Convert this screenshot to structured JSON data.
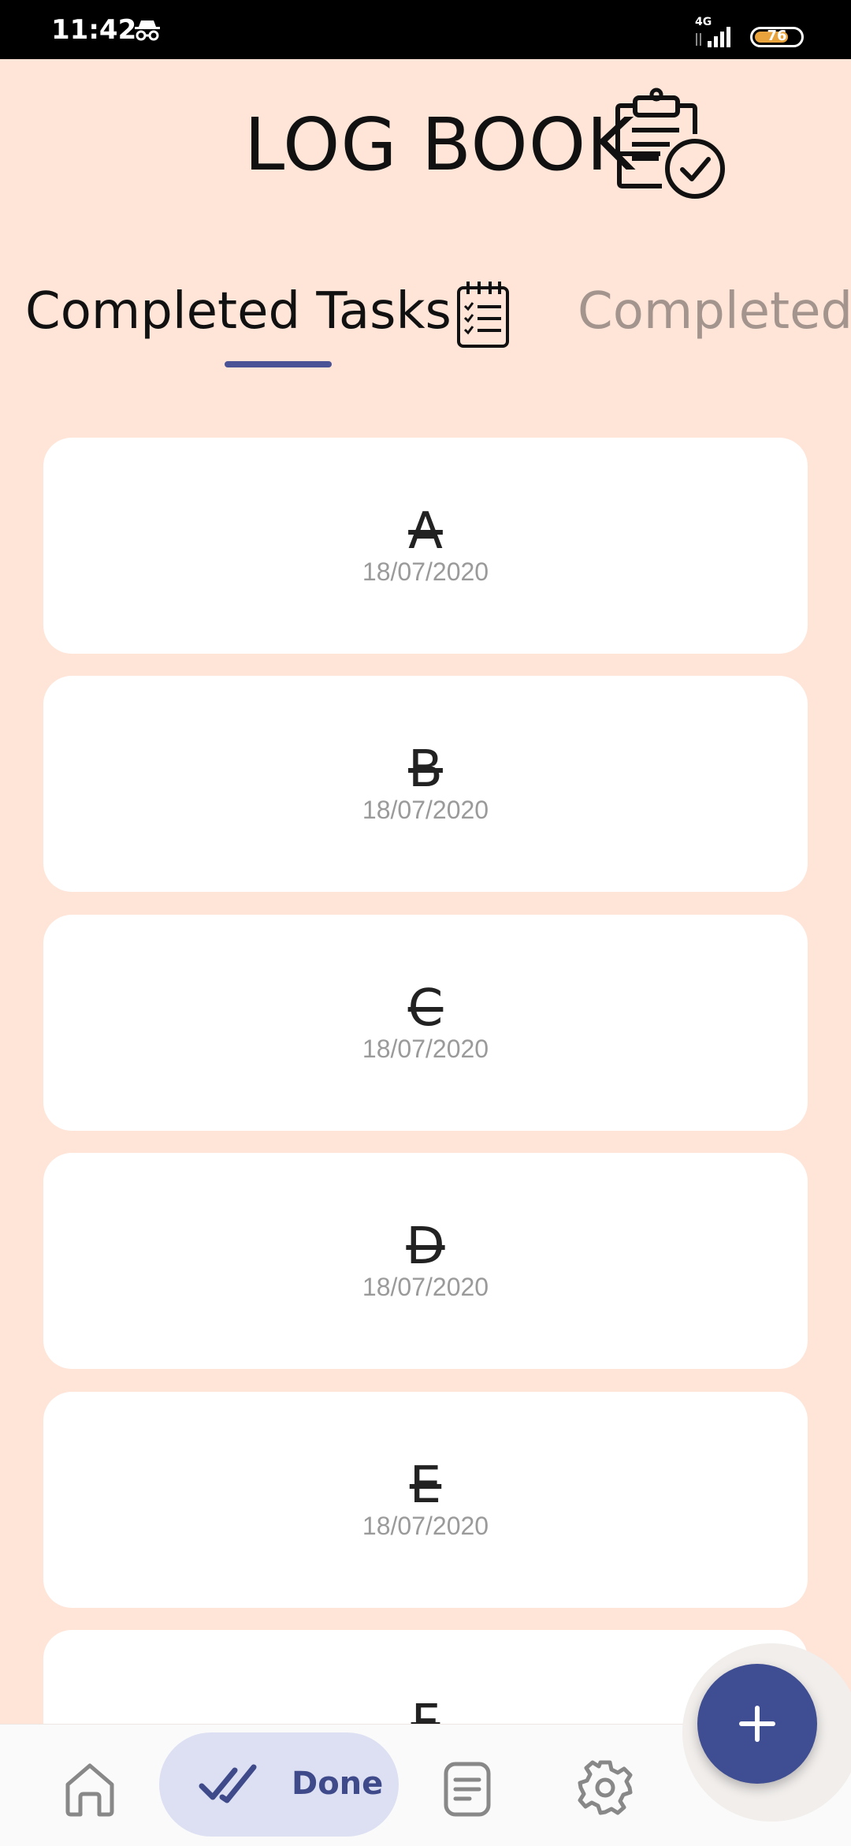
{
  "status_bar": {
    "time": "11:42",
    "network": "4G",
    "battery": "76",
    "icons": [
      "incognito-icon",
      "signal-icon",
      "battery-icon"
    ]
  },
  "header": {
    "title": "LOG BOOK",
    "icon": "clipboard-check-icon"
  },
  "tabs": [
    {
      "label": "Completed Tasks",
      "icon": "notebook-icon",
      "active": true
    },
    {
      "label": "Completed",
      "active": false
    }
  ],
  "tasks": [
    {
      "name": "A",
      "date": "18/07/2020"
    },
    {
      "name": "B",
      "date": "18/07/2020"
    },
    {
      "name": "C",
      "date": "18/07/2020"
    },
    {
      "name": "D",
      "date": "18/07/2020"
    },
    {
      "name": "E",
      "date": "18/07/2020"
    },
    {
      "name": "F",
      "date": ""
    }
  ],
  "bottom_nav": {
    "items": [
      {
        "icon": "home-icon",
        "label": ""
      },
      {
        "icon": "double-check-icon",
        "label": "Done",
        "active": true
      },
      {
        "icon": "notes-icon",
        "label": ""
      },
      {
        "icon": "gear-icon",
        "label": ""
      }
    ]
  },
  "fab": {
    "icon": "plus-icon"
  },
  "colors": {
    "background": "#FFE4D8",
    "accent": "#3F4D93",
    "active_pill": "#DCE0F2",
    "muted_text": "#9A9A9A"
  }
}
